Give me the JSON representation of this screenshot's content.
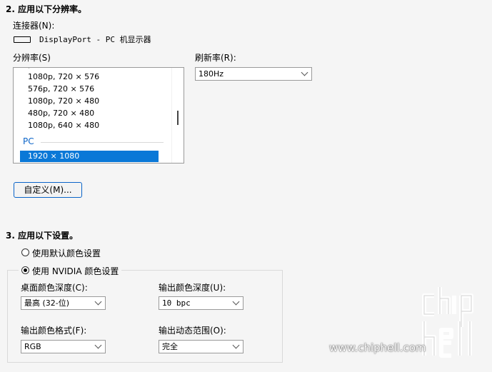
{
  "section2": {
    "heading": "2. 应用以下分辨率。"
  },
  "connector": {
    "label": "连接器(N):",
    "value": "DisplayPort - PC 机显示器"
  },
  "resolution": {
    "label": "分辨率(S)",
    "items": [
      "1080p, 720 × 576",
      "576p, 720 × 576",
      "1080p, 720 × 480",
      "480p, 720 × 480",
      "1080p, 640 × 480"
    ],
    "group": "PC",
    "selected": "1920 × 1080"
  },
  "refresh": {
    "label": "刷新率(R):",
    "value": "180Hz"
  },
  "custom_button": "自定义(M)...",
  "section3": {
    "heading": "3. 应用以下设置。"
  },
  "color": {
    "option_default": "使用默认颜色设置",
    "option_nvidia": "使用 NVIDIA 颜色设置",
    "desktop_depth": {
      "label": "桌面颜色深度(C):",
      "value": "最高 (32-位)"
    },
    "output_depth": {
      "label": "输出颜色深度(U):",
      "value": "10 bpc"
    },
    "output_format": {
      "label": "输出颜色格式(F):",
      "value": "RGB"
    },
    "dynamic_range": {
      "label": "输出动态范围(O):",
      "value": "完全"
    }
  },
  "watermark": {
    "logo": "chip hell",
    "url": "www.chiphell.com"
  }
}
